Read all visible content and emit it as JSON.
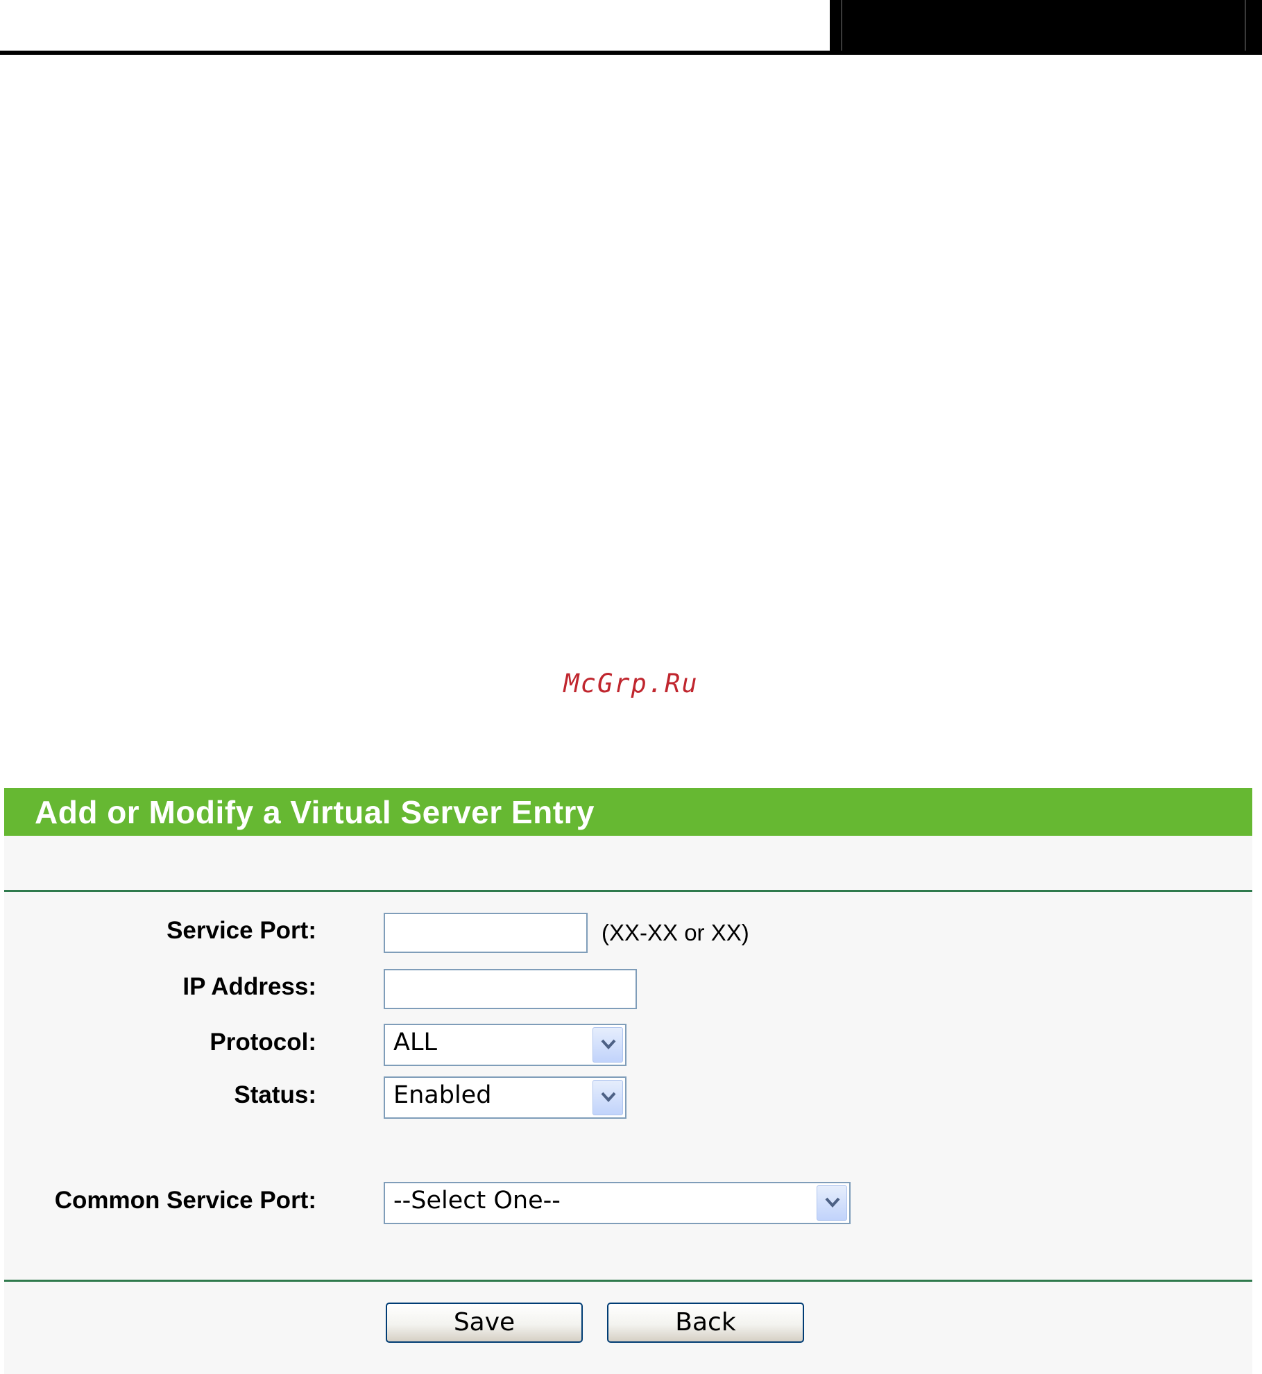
{
  "watermark": "McGrp.Ru",
  "panel": {
    "title": "Add or Modify a Virtual Server Entry",
    "accent_color": "#66b832"
  },
  "form": {
    "service_port": {
      "label": "Service Port:",
      "value": "",
      "hint": "(XX-XX or XX)"
    },
    "ip_address": {
      "label": "IP Address:",
      "value": ""
    },
    "protocol": {
      "label": "Protocol:",
      "selected": "ALL"
    },
    "status": {
      "label": "Status:",
      "selected": "Enabled"
    },
    "common_service_port": {
      "label": "Common Service Port:",
      "selected": "--Select One--"
    }
  },
  "buttons": {
    "save": "Save",
    "back": "Back"
  },
  "icons": {
    "dropdown": "chevron-down-icon"
  }
}
